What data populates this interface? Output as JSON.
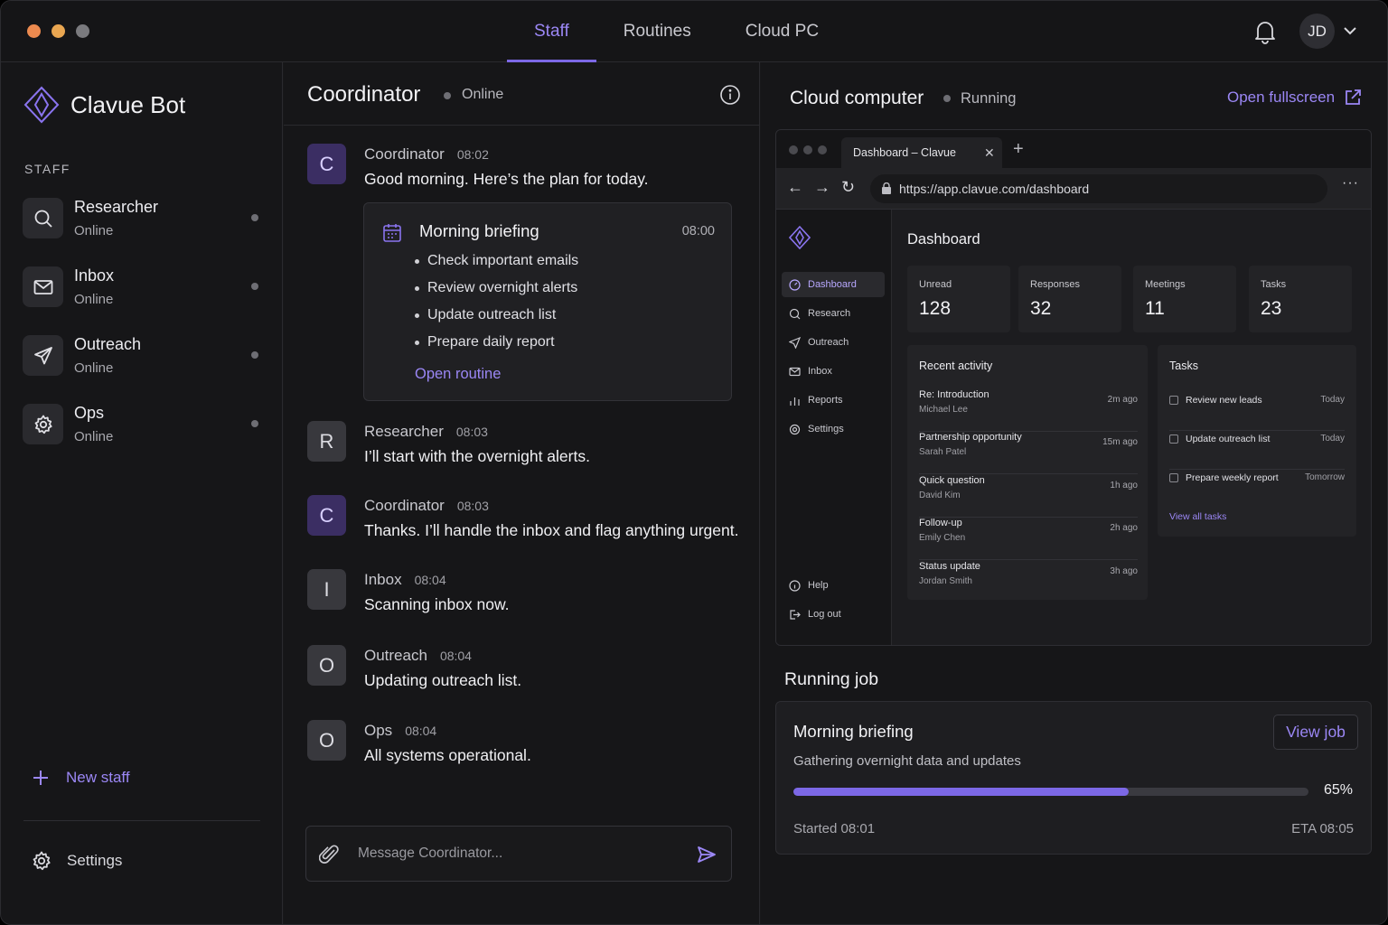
{
  "topbar": {
    "tabs": [
      {
        "label": "Staff",
        "active": true
      },
      {
        "label": "Routines",
        "active": false
      },
      {
        "label": "Cloud PC",
        "active": false
      }
    ],
    "user_initials": "JD"
  },
  "sidebar": {
    "brand": "Clavue Bot",
    "section_label": "STAFF",
    "items": [
      {
        "name": "Researcher",
        "status": "Online",
        "icon": "search-icon"
      },
      {
        "name": "Inbox",
        "status": "Online",
        "icon": "mail-icon"
      },
      {
        "name": "Outreach",
        "status": "Online",
        "icon": "send-icon"
      },
      {
        "name": "Ops",
        "status": "Online",
        "icon": "gear-icon"
      }
    ],
    "new_staff_label": "New staff",
    "settings_label": "Settings"
  },
  "chat": {
    "title": "Coordinator",
    "status": "Online",
    "messages": [
      {
        "initial": "C",
        "sender": "Coordinator",
        "time": "08:02",
        "text": "Good morning. Here’s the plan for today."
      },
      {
        "initial": "R",
        "sender": "Researcher",
        "time": "08:03",
        "text": "I’ll start with the overnight alerts."
      },
      {
        "initial": "C",
        "sender": "Coordinator",
        "time": "08:03",
        "text": "Thanks. I’ll handle the inbox and flag anything urgent."
      },
      {
        "initial": "I",
        "sender": "Inbox",
        "time": "08:04",
        "text": "Scanning inbox now."
      },
      {
        "initial": "O",
        "sender": "Outreach",
        "time": "08:04",
        "text": "Updating outreach list."
      },
      {
        "initial": "O",
        "sender": "Ops",
        "time": "08:04",
        "text": "All systems operational."
      }
    ],
    "briefing": {
      "title": "Morning briefing",
      "time": "08:00",
      "items": [
        "Check important emails",
        "Review overnight alerts",
        "Update outreach list",
        "Prepare daily report"
      ],
      "link": "Open routine"
    },
    "composer_placeholder": "Message Coordinator..."
  },
  "cloud": {
    "title": "Cloud computer",
    "status": "Running",
    "fullscreen_label": "Open fullscreen",
    "browser": {
      "tab_title": "Dashboard – Clavue",
      "url": "https://app.clavue.com/dashboard",
      "nav": [
        "Dashboard",
        "Research",
        "Outreach",
        "Inbox",
        "Reports",
        "Settings"
      ],
      "nav_bottom": [
        "Help",
        "Log out"
      ],
      "heading": "Dashboard",
      "stats": [
        {
          "label": "Unread",
          "value": "128"
        },
        {
          "label": "Responses",
          "value": "32"
        },
        {
          "label": "Meetings",
          "value": "11"
        },
        {
          "label": "Tasks",
          "value": "23"
        }
      ],
      "activity_title": "Recent activity",
      "activity": [
        {
          "title": "Re: Introduction",
          "person": "Michael Lee",
          "time": "2m ago"
        },
        {
          "title": "Partnership opportunity",
          "person": "Sarah Patel",
          "time": "15m ago"
        },
        {
          "title": "Quick question",
          "person": "David Kim",
          "time": "1h ago"
        },
        {
          "title": "Follow-up",
          "person": "Emily Chen",
          "time": "2h ago"
        },
        {
          "title": "Status update",
          "person": "Jordan Smith",
          "time": "3h ago"
        }
      ],
      "tasks_title": "Tasks",
      "tasks": [
        {
          "label": "Review new leads",
          "due": "Today"
        },
        {
          "label": "Update outreach list",
          "due": "Today"
        },
        {
          "label": "Prepare weekly report",
          "due": "Tomorrow"
        }
      ],
      "view_all": "View all tasks"
    },
    "job": {
      "heading": "Running job",
      "title": "Morning briefing",
      "description": "Gathering overnight data and updates",
      "button": "View job",
      "progress": 65,
      "progress_label": "65%",
      "started": "Started 08:01",
      "eta": "ETA 08:05"
    }
  },
  "colors": {
    "accent": "#9b87f5",
    "accent_strong": "#7c68e6",
    "background": "#161618"
  }
}
